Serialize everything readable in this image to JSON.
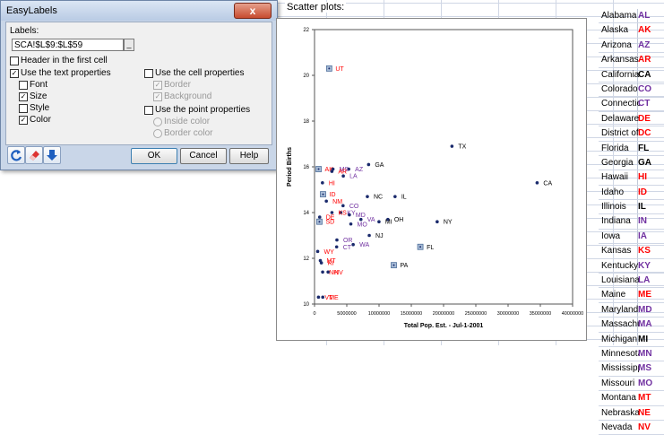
{
  "sheet": {
    "scatter_heading": "Scatter plots:"
  },
  "dialog": {
    "title": "EasyLabels",
    "close": "x",
    "labels_label": "Labels:",
    "labels_value": "SCA!$L$9:$L$59",
    "ref_button": "_",
    "header_first_cell": "Header in the first cell",
    "use_text_props": "Use the text properties",
    "font": "Font",
    "size": "Size",
    "style": "Style",
    "color": "Color",
    "use_cell_props": "Use the cell properties",
    "border": "Border",
    "background": "Background",
    "use_point_props": "Use the point properties",
    "inside_color": "Inside color",
    "border_color": "Border color",
    "ok": "OK",
    "cancel": "Cancel",
    "help": "Help"
  },
  "states": [
    {
      "name": "Alabama",
      "abbr": "AL",
      "color": "#7030a0"
    },
    {
      "name": "Alaska",
      "abbr": "AK",
      "color": "#ff0000"
    },
    {
      "name": "Arizona",
      "abbr": "AZ",
      "color": "#7030a0"
    },
    {
      "name": "Arkansas",
      "abbr": "AR",
      "color": "#ff0000"
    },
    {
      "name": "California",
      "abbr": "CA",
      "color": "#000000"
    },
    {
      "name": "Colorado",
      "abbr": "CO",
      "color": "#7030a0"
    },
    {
      "name": "Connecticut",
      "abbr": "CT",
      "color": "#7030a0"
    },
    {
      "name": "Delaware",
      "abbr": "DE",
      "color": "#ff0000"
    },
    {
      "name": "District of Columbia",
      "abbr": "DC",
      "color": "#ff0000"
    },
    {
      "name": "Florida",
      "abbr": "FL",
      "color": "#000000"
    },
    {
      "name": "Georgia",
      "abbr": "GA",
      "color": "#000000"
    },
    {
      "name": "Hawaii",
      "abbr": "HI",
      "color": "#ff0000"
    },
    {
      "name": "Idaho",
      "abbr": "ID",
      "color": "#ff0000"
    },
    {
      "name": "Illinois",
      "abbr": "IL",
      "color": "#000000"
    },
    {
      "name": "Indiana",
      "abbr": "IN",
      "color": "#7030a0"
    },
    {
      "name": "Iowa",
      "abbr": "IA",
      "color": "#7030a0"
    },
    {
      "name": "Kansas",
      "abbr": "KS",
      "color": "#ff0000"
    },
    {
      "name": "Kentucky",
      "abbr": "KY",
      "color": "#7030a0"
    },
    {
      "name": "Louisiana",
      "abbr": "LA",
      "color": "#7030a0"
    },
    {
      "name": "Maine",
      "abbr": "ME",
      "color": "#ff0000"
    },
    {
      "name": "Maryland",
      "abbr": "MD",
      "color": "#7030a0"
    },
    {
      "name": "Massachusetts",
      "abbr": "MA",
      "color": "#7030a0"
    },
    {
      "name": "Michigan",
      "abbr": "MI",
      "color": "#000000"
    },
    {
      "name": "Minnesota",
      "abbr": "MN",
      "color": "#7030a0"
    },
    {
      "name": "Mississippi",
      "abbr": "MS",
      "color": "#7030a0"
    },
    {
      "name": "Missouri",
      "abbr": "MO",
      "color": "#7030a0"
    },
    {
      "name": "Montana",
      "abbr": "MT",
      "color": "#ff0000"
    },
    {
      "name": "Nebraska",
      "abbr": "NE",
      "color": "#ff0000"
    },
    {
      "name": "Nevada",
      "abbr": "NV",
      "color": "#ff0000"
    }
  ],
  "chart_data": {
    "type": "scatter",
    "title": "",
    "xlabel": "Total Pop. Est. - Jul-1-2001",
    "ylabel": "Period Births",
    "xlim": [
      0,
      40000000
    ],
    "ylim": [
      10,
      22
    ],
    "xticks": [
      "0",
      "5000000",
      "10000000",
      "15000000",
      "20000000",
      "25000000",
      "30000000",
      "35000000",
      "40000000"
    ],
    "yticks": [
      "10",
      "12",
      "14",
      "16",
      "18",
      "20",
      "22"
    ],
    "grid": false,
    "points": [
      {
        "label": "UT",
        "x": 2270000,
        "y": 20.3,
        "color": "#ff0000",
        "marker": "square"
      },
      {
        "label": "TX",
        "x": 21300000,
        "y": 16.9,
        "color": "#000000",
        "marker": "dot"
      },
      {
        "label": "CA",
        "x": 34500000,
        "y": 15.3,
        "color": "#000000",
        "marker": "dot"
      },
      {
        "label": "GA",
        "x": 8380000,
        "y": 16.1,
        "color": "#000000",
        "marker": "dot"
      },
      {
        "label": "AZ",
        "x": 5300000,
        "y": 15.9,
        "color": "#7030a0",
        "marker": "dot"
      },
      {
        "label": "MS",
        "x": 2860000,
        "y": 15.9,
        "color": "#7030a0",
        "marker": "dot"
      },
      {
        "label": "AK",
        "x": 630000,
        "y": 15.9,
        "color": "#ff0000",
        "marker": "square"
      },
      {
        "label": "AR",
        "x": 2690000,
        "y": 15.8,
        "color": "#ff0000",
        "marker": "dot"
      },
      {
        "label": "LA",
        "x": 4460000,
        "y": 15.6,
        "color": "#7030a0",
        "marker": "dot"
      },
      {
        "label": "HI",
        "x": 1230000,
        "y": 15.3,
        "color": "#ff0000",
        "marker": "dot"
      },
      {
        "label": "ID",
        "x": 1320000,
        "y": 14.8,
        "color": "#ff0000",
        "marker": "square"
      },
      {
        "label": "NC",
        "x": 8190000,
        "y": 14.7,
        "color": "#000000",
        "marker": "dot"
      },
      {
        "label": "IL",
        "x": 12480000,
        "y": 14.7,
        "color": "#000000",
        "marker": "dot"
      },
      {
        "label": "NM",
        "x": 1830000,
        "y": 14.5,
        "color": "#ff0000",
        "marker": "dot"
      },
      {
        "label": "CO",
        "x": 4420000,
        "y": 14.3,
        "color": "#7030a0",
        "marker": "dot"
      },
      {
        "label": "KY",
        "x": 4070000,
        "y": 14.0,
        "color": "#7030a0",
        "marker": "dot"
      },
      {
        "label": "MD",
        "x": 5400000,
        "y": 13.9,
        "color": "#7030a0",
        "marker": "dot"
      },
      {
        "label": "KS",
        "x": 2700000,
        "y": 14.0,
        "color": "#ff0000",
        "marker": "dot"
      },
      {
        "label": "DE",
        "x": 800000,
        "y": 13.8,
        "color": "#ff0000",
        "marker": "dot"
      },
      {
        "label": "VA",
        "x": 7190000,
        "y": 13.7,
        "color": "#7030a0",
        "marker": "dot"
      },
      {
        "label": "OH",
        "x": 11370000,
        "y": 13.7,
        "color": "#000000",
        "marker": "dot"
      },
      {
        "label": "MI",
        "x": 9990000,
        "y": 13.6,
        "color": "#000000",
        "marker": "dot"
      },
      {
        "label": "NY",
        "x": 19010000,
        "y": 13.6,
        "color": "#000000",
        "marker": "dot"
      },
      {
        "label": "SD",
        "x": 760000,
        "y": 13.6,
        "color": "#ff0000",
        "marker": "square"
      },
      {
        "label": "MO",
        "x": 5630000,
        "y": 13.5,
        "color": "#7030a0",
        "marker": "dot"
      },
      {
        "label": "NJ",
        "x": 8480000,
        "y": 13.0,
        "color": "#000000",
        "marker": "dot"
      },
      {
        "label": "OR",
        "x": 3470000,
        "y": 12.8,
        "color": "#7030a0",
        "marker": "dot"
      },
      {
        "label": "WA",
        "x": 5990000,
        "y": 12.6,
        "color": "#7030a0",
        "marker": "dot"
      },
      {
        "label": "CT",
        "x": 3430000,
        "y": 12.5,
        "color": "#7030a0",
        "marker": "dot"
      },
      {
        "label": "FL",
        "x": 16400000,
        "y": 12.5,
        "color": "#000000",
        "marker": "square"
      },
      {
        "label": "WY",
        "x": 490000,
        "y": 12.3,
        "color": "#ff0000",
        "marker": "dot"
      },
      {
        "label": "MT",
        "x": 900000,
        "y": 11.9,
        "color": "#ff0000",
        "marker": "dot"
      },
      {
        "label": "RI",
        "x": 1060000,
        "y": 11.8,
        "color": "#ff0000",
        "marker": "dot"
      },
      {
        "label": "PA",
        "x": 12290000,
        "y": 11.7,
        "color": "#000000",
        "marker": "square"
      },
      {
        "label": "NH",
        "x": 1260000,
        "y": 11.4,
        "color": "#ff0000",
        "marker": "dot"
      },
      {
        "label": "NV",
        "x": 2100000,
        "y": 11.4,
        "color": "#ff0000",
        "marker": "dot"
      },
      {
        "label": "VT",
        "x": 610000,
        "y": 10.3,
        "color": "#ff0000",
        "marker": "dot"
      },
      {
        "label": "ME",
        "x": 1280000,
        "y": 10.3,
        "color": "#ff0000",
        "marker": "dot"
      }
    ]
  }
}
